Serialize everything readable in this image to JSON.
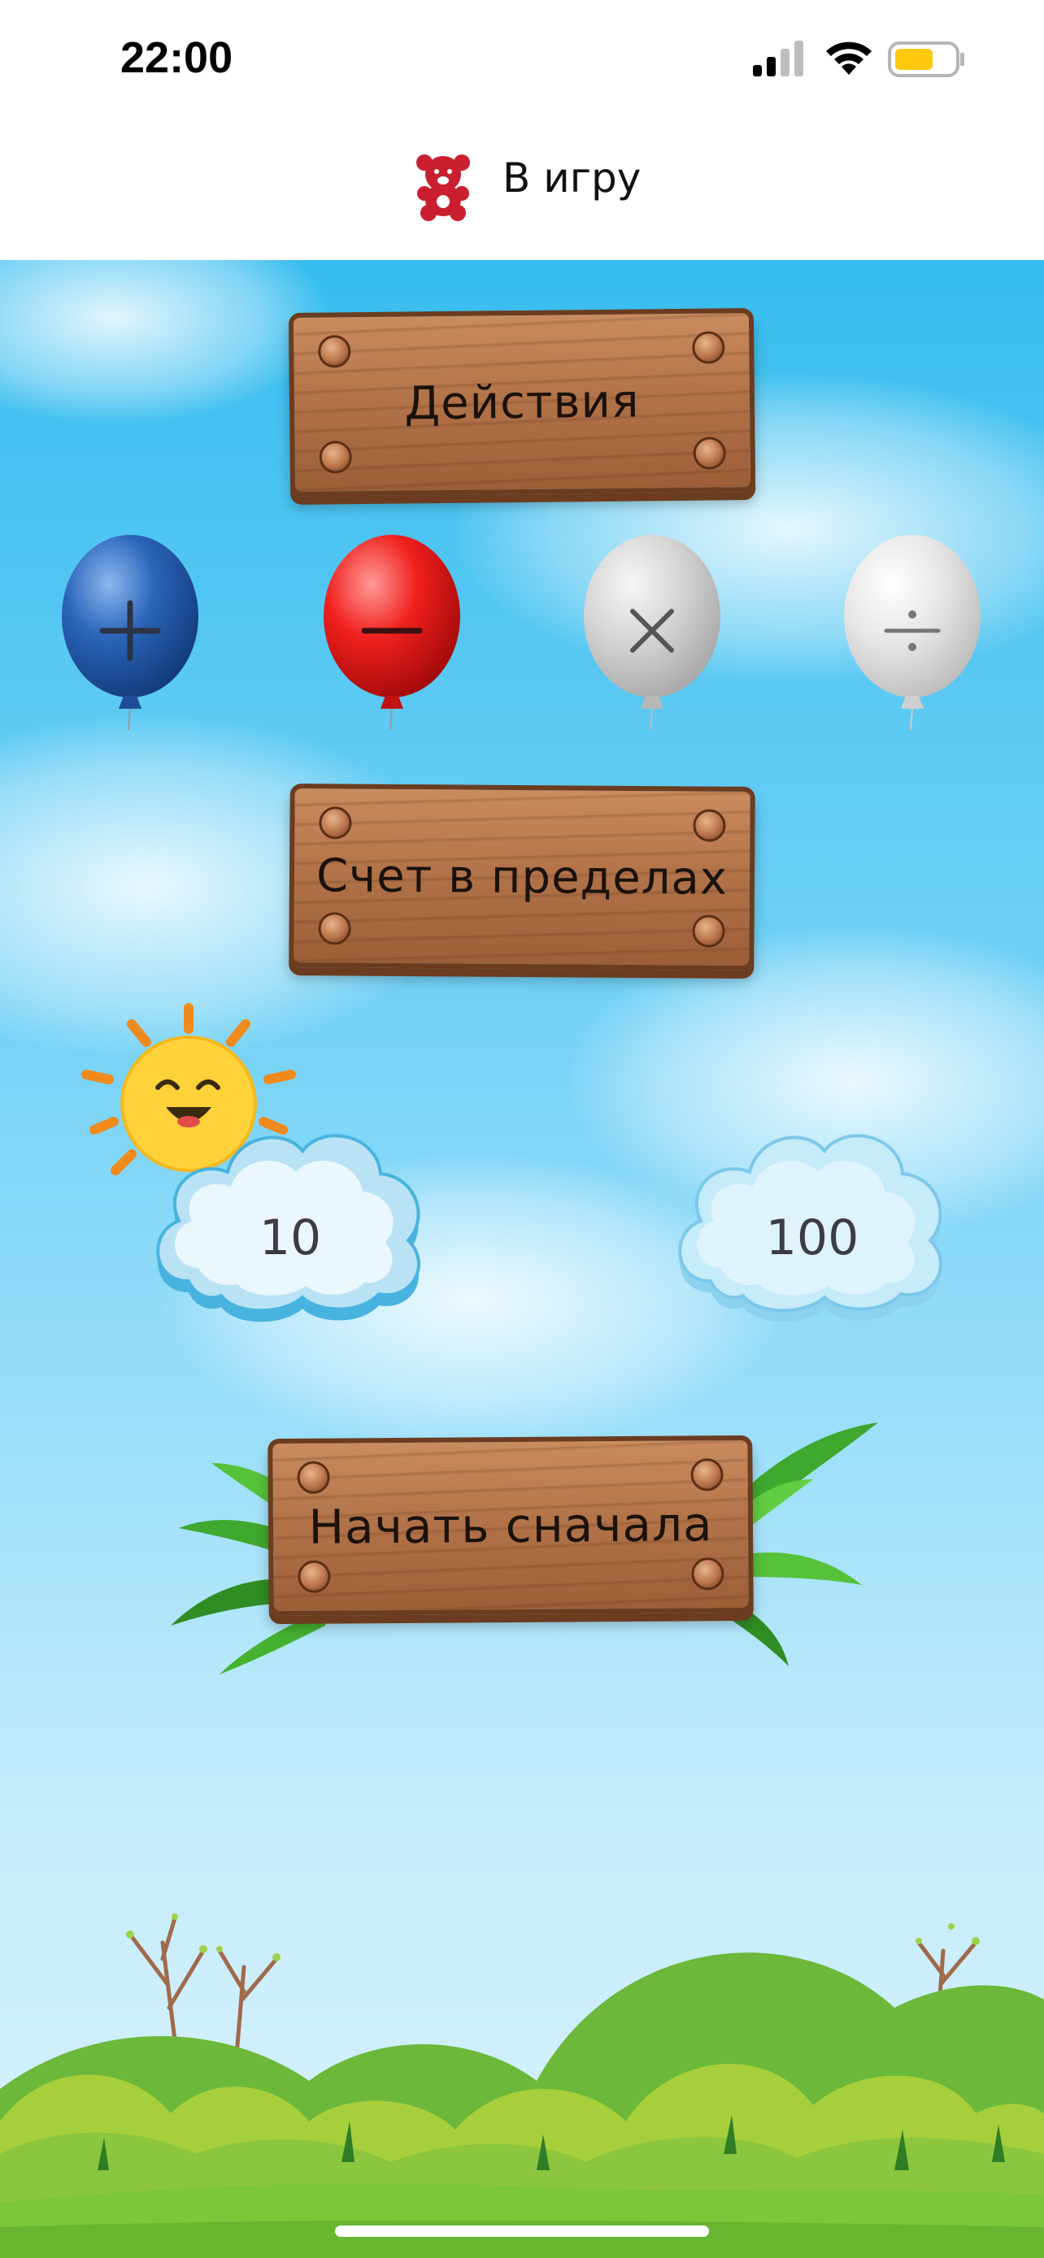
{
  "status_bar": {
    "time": "22:00",
    "icons": [
      "signal-icon",
      "wifi-icon",
      "battery-icon"
    ],
    "battery_color": "#ffc90d"
  },
  "header": {
    "icon": "teddy-bear-icon",
    "icon_color": "#c91f2e",
    "title": "В игру"
  },
  "operations": {
    "title": "Действия",
    "items": [
      {
        "name": "plus-icon",
        "symbol": "+",
        "color": "#2a64b8",
        "state": "selected"
      },
      {
        "name": "minus-icon",
        "symbol": "−",
        "color": "#f0201e",
        "state": "selected"
      },
      {
        "name": "multiply-icon",
        "symbol": "×",
        "color": "#d4d4d4",
        "state": "unselected"
      },
      {
        "name": "divide-icon",
        "symbol": "÷",
        "color": "#e6e6e6",
        "state": "unselected"
      }
    ]
  },
  "range": {
    "title": "Счет в пределах",
    "options": [
      {
        "label": "10",
        "selected": true
      },
      {
        "label": "100",
        "selected": false
      }
    ]
  },
  "restart": {
    "label": "Начать сначала"
  },
  "colors": {
    "sky_top": "#38bdef",
    "sky_bottom": "#d9f2fc",
    "grass": "#7cc63a",
    "wood": "#b3744a",
    "sun": "#ffd23a"
  }
}
